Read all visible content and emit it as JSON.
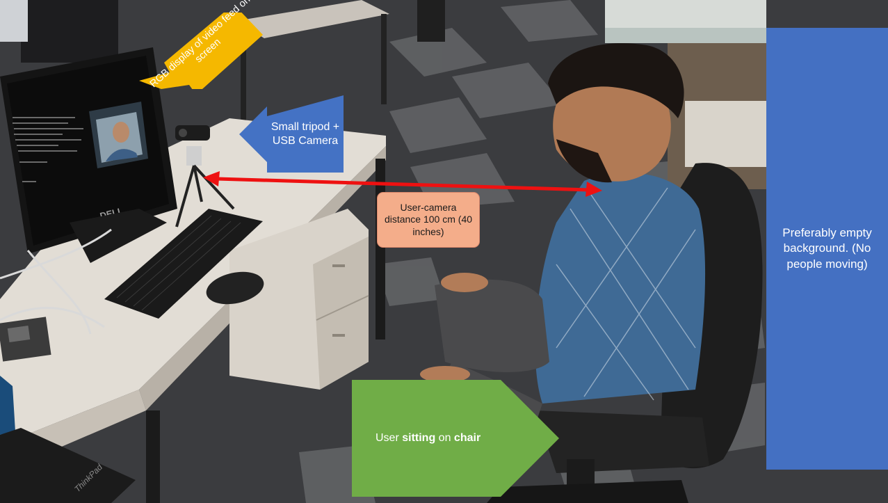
{
  "callouts": {
    "rgb_display": {
      "text": "RGB display of video feed on screen",
      "color": "#f5b800",
      "arrow": "down-left"
    },
    "camera": {
      "text": "Small tripod + USB Camera",
      "color": "#4472c4",
      "arrow": "left"
    },
    "distance": {
      "text": "User-camera distance 100 cm (40 inches)",
      "color": "#f4ad8a"
    },
    "background": {
      "text": "Preferably empty background. (No people moving)",
      "color": "#4470c2"
    },
    "user": {
      "prefix": "User ",
      "bold1": "sitting",
      "middle": " on ",
      "bold2": "chair",
      "color": "#70ad47"
    }
  },
  "measurement_line": {
    "color": "#ee1111"
  },
  "photo": {
    "monitor_brand": "DELL",
    "laptop_brand": "ThinkPad"
  }
}
